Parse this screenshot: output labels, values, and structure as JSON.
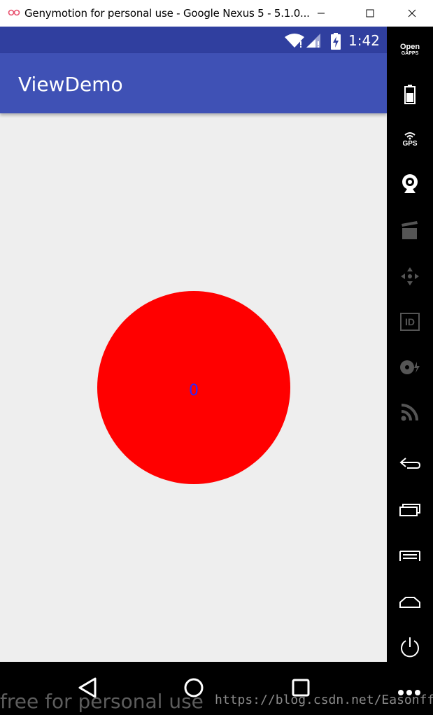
{
  "window": {
    "title": "Genymotion for personal use - Google Nexus 5 - 5.1.0...",
    "icon": "genymotion-logo-icon",
    "controls": [
      "minimize-icon",
      "maximize-icon",
      "close-icon"
    ]
  },
  "status_bar": {
    "time": "1:42",
    "icons": [
      "wifi-icon",
      "signal-icon",
      "battery-charging-icon"
    ]
  },
  "app_bar": {
    "title": "ViewDemo"
  },
  "content": {
    "circle_value": "0",
    "circle_color": "#ff0000",
    "value_color": "#2a28ff"
  },
  "sidebar": {
    "opengapps_line1": "Open",
    "opengapps_line2": "GAPPS",
    "gps_label": "GPS",
    "id_label": "ID",
    "tools": [
      "battery-icon",
      "gps-icon",
      "webcam-icon",
      "capture-icon",
      "dpad-icon",
      "identifiers-icon",
      "disk-io-icon",
      "network-icon",
      "back-icon",
      "recent-apps-icon",
      "menu-icon",
      "home-icon",
      "power-icon"
    ]
  },
  "nav": {
    "buttons": [
      "back-triangle-icon",
      "home-circle-icon",
      "recents-square-icon"
    ]
  },
  "watermarks": {
    "left": "free for personal use",
    "right": "https://blog.csdn.net/Easonfff"
  },
  "colors": {
    "status_bar": "#303f9f",
    "app_bar": "#3f51b5",
    "background": "#eeeeee"
  }
}
